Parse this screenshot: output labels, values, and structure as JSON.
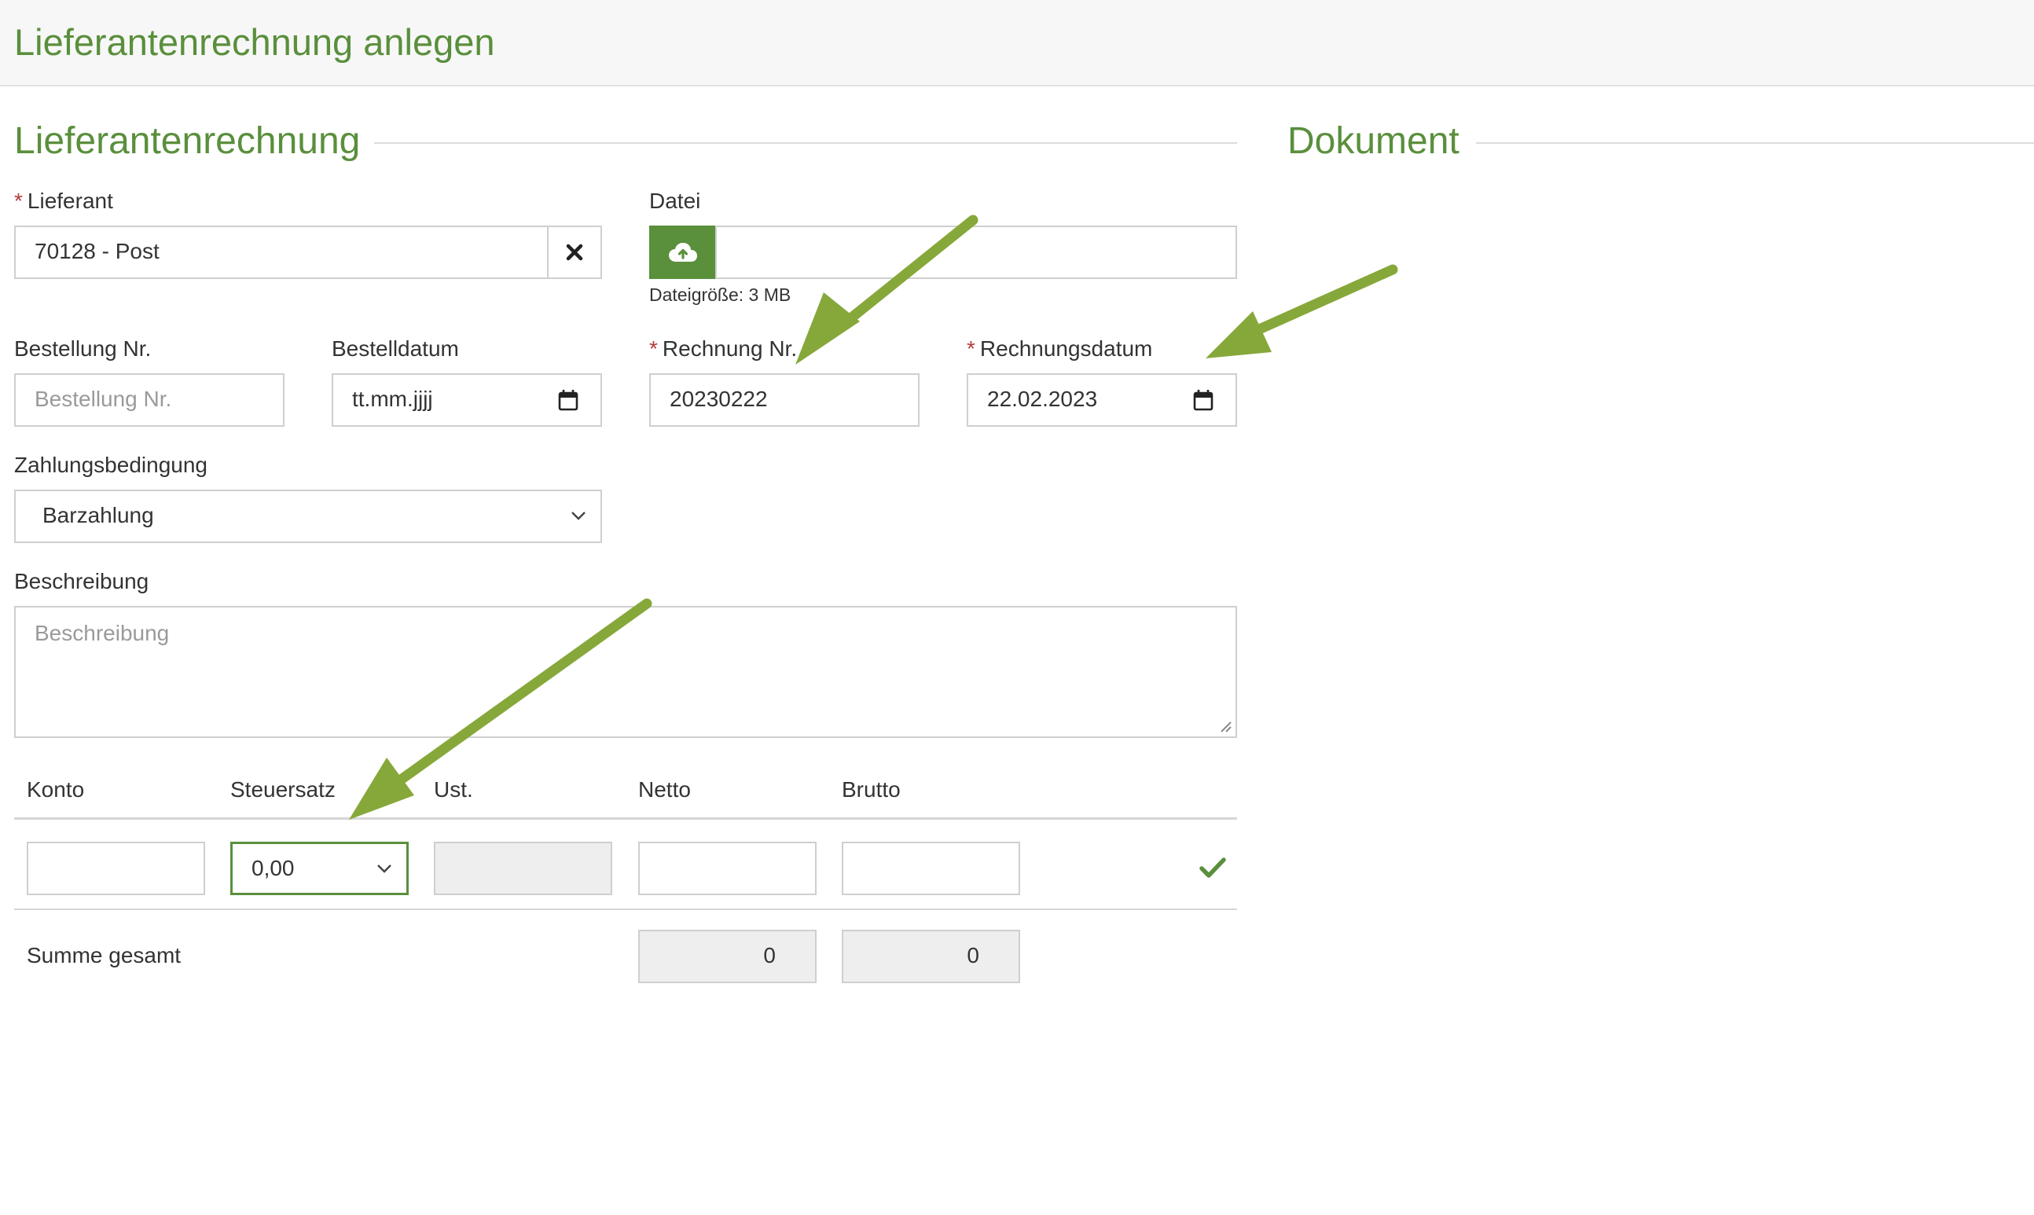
{
  "page": {
    "title": "Lieferantenrechnung anlegen"
  },
  "sections": {
    "invoice_title": "Lieferantenrechnung",
    "document_title": "Dokument"
  },
  "colors": {
    "accent": "#5a8f3c",
    "required": "#b33a3a",
    "annotation_arrow": "#86a83a"
  },
  "form": {
    "required_marker": "*",
    "supplier": {
      "label": "Lieferant",
      "value": "70128 - Post",
      "clear_icon": "close-icon"
    },
    "file": {
      "label": "Datei",
      "upload_icon": "cloud-upload-icon",
      "size_hint": "Dateigröße: 3 MB"
    },
    "order_no": {
      "label": "Bestellung Nr.",
      "placeholder": "Bestellung Nr."
    },
    "order_date": {
      "label": "Bestelldatum",
      "value": "tt.mm.jjjj",
      "icon": "calendar-icon"
    },
    "invoice_no": {
      "label": "Rechnung Nr.",
      "value": "20230222"
    },
    "invoice_date": {
      "label": "Rechnungsdatum",
      "value": "22.02.2023",
      "icon": "calendar-icon"
    },
    "payment_terms": {
      "label": "Zahlungsbedingung",
      "value": "Barzahlung"
    },
    "description": {
      "label": "Beschreibung",
      "placeholder": "Beschreibung"
    }
  },
  "table": {
    "headers": [
      "Konto",
      "Steuersatz",
      "Ust.",
      "Netto",
      "Brutto"
    ],
    "row": {
      "konto": "",
      "steuersatz": "0,00",
      "ust": "",
      "netto": "",
      "brutto": "",
      "confirm_icon": "checkmark-icon"
    },
    "total": {
      "label": "Summe gesamt",
      "netto": "0",
      "brutto": "0"
    }
  }
}
